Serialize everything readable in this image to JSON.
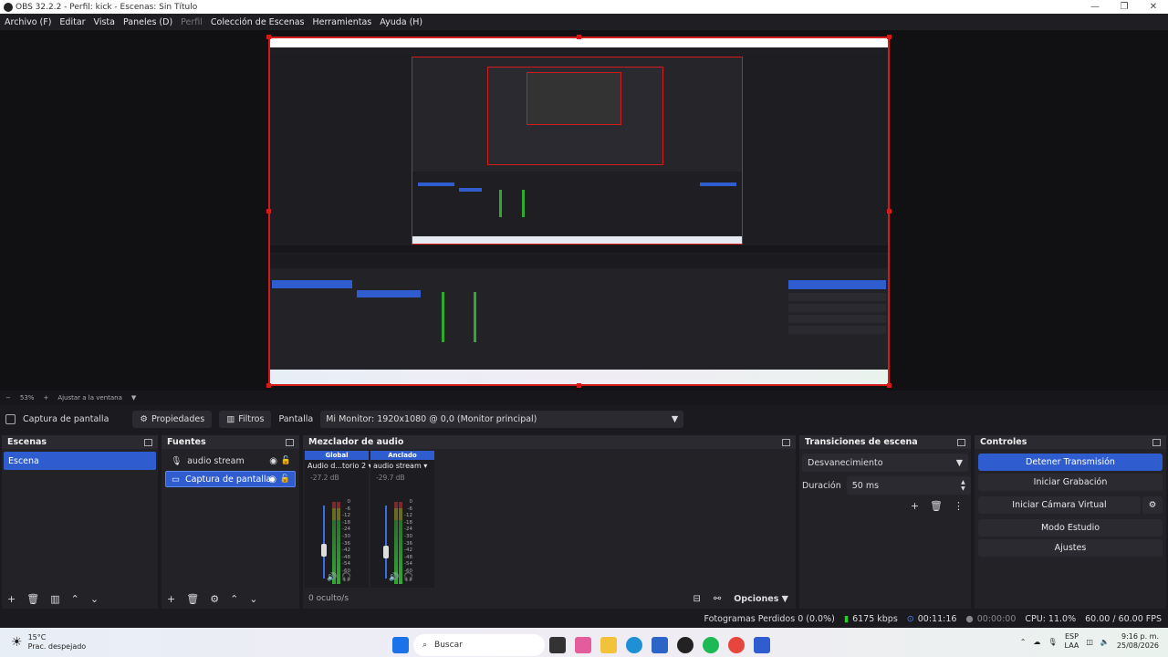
{
  "window": {
    "title": "OBS 32.2.2 - Perfil: kick - Escenas: Sin Título"
  },
  "menu": [
    "Archivo (F)",
    "Editar",
    "Vista",
    "Paneles (D)",
    "Perfil",
    "Colección de Escenas",
    "Herramientas",
    "Ayuda (H)"
  ],
  "zoom": {
    "value": "53%",
    "fit": "Ajustar a la ventana"
  },
  "source_bar": {
    "selected_source": "Captura de pantalla",
    "properties": "Propiedades",
    "filters": "Filtros",
    "screen_label": "Pantalla",
    "screen_value": "Mi Monitor: 1920x1080 @ 0,0 (Monitor principal)"
  },
  "scenes": {
    "title": "Escenas",
    "items": [
      "Escena"
    ]
  },
  "sources": {
    "title": "Fuentes",
    "items": [
      "audio stream",
      "Captura de pantalla"
    ]
  },
  "mixer": {
    "title": "Mezclador de audio",
    "channels": [
      {
        "tag": "Global",
        "name": "Audio d...torio 2",
        "db": "-27.2 dB"
      },
      {
        "tag": "Anclado",
        "name": "audio stream",
        "db": "-29.7 dB"
      }
    ],
    "scale": [
      "0",
      "-6",
      "-12",
      "-18",
      "-24",
      "-30",
      "-36",
      "-42",
      "-48",
      "-54",
      "-60"
    ],
    "hidden": "0 oculto/s",
    "options": "Opciones"
  },
  "transitions": {
    "title": "Transiciones de escena",
    "selected": "Desvanecimiento",
    "duration_label": "Duración",
    "duration": "50 ms"
  },
  "controls": {
    "title": "Controles",
    "stop_stream": "Detener Transmisión",
    "start_recording": "Iniciar Grabación",
    "start_virtual_cam": "Iniciar Cámara Virtual",
    "studio_mode": "Modo Estudio",
    "settings": "Ajustes"
  },
  "status": {
    "dropped": "Fotogramas Perdidos 0 (0.0%)",
    "bitrate": "6175 kbps",
    "stream_time": "00:11:16",
    "rec_time": "00:00:00",
    "cpu": "CPU: 11.0%",
    "fps": "60.00 / 60.00 FPS"
  },
  "taskbar": {
    "weather_temp": "15°C",
    "weather_desc": "Prac. despejado",
    "search": "Buscar",
    "lang": "ESP",
    "lang2": "LAA",
    "time": "9:16 p. m.",
    "date": "25/08/2026"
  }
}
